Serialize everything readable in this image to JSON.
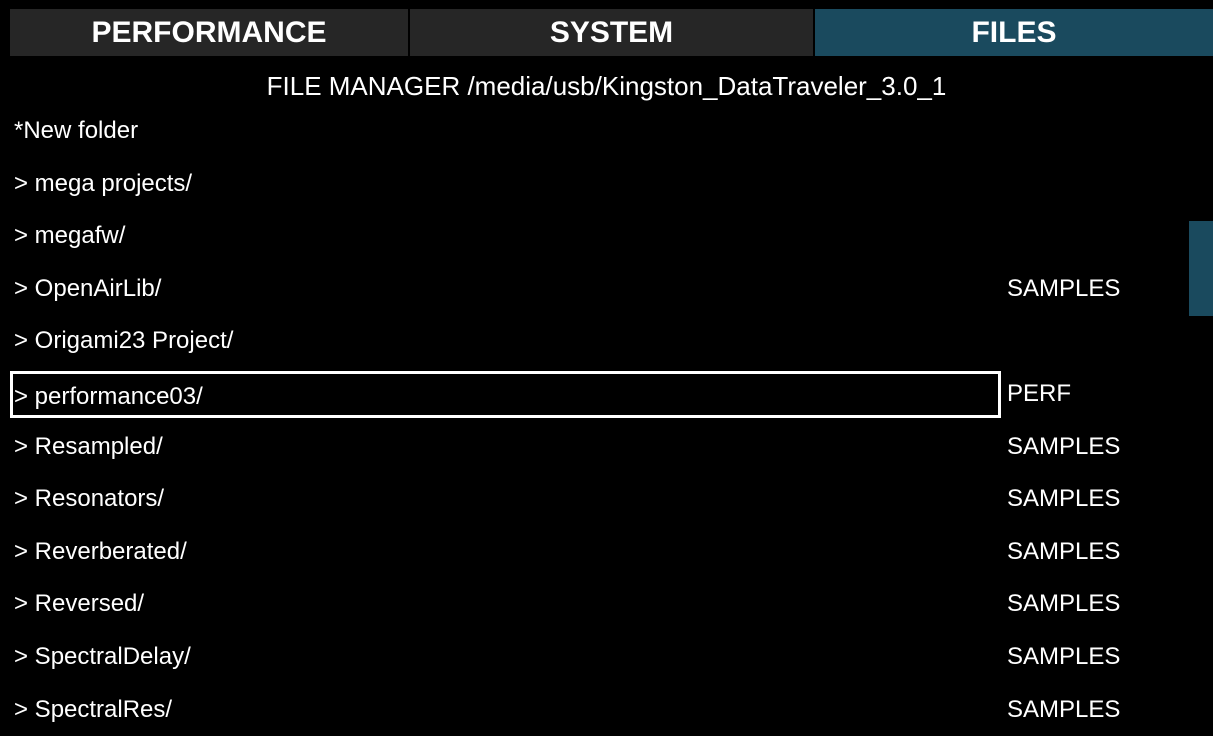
{
  "tabs": [
    {
      "label": "PERFORMANCE",
      "active": false
    },
    {
      "label": "SYSTEM",
      "active": false
    },
    {
      "label": "FILES",
      "active": true
    }
  ],
  "header": {
    "title": "FILE MANAGER /media/usb/Kingston_DataTraveler_3.0_1"
  },
  "files": [
    {
      "name": "*New folder",
      "tag": ""
    },
    {
      "name": "> mega projects/",
      "tag": ""
    },
    {
      "name": "> megafw/",
      "tag": ""
    },
    {
      "name": "> OpenAirLib/",
      "tag": "SAMPLES"
    },
    {
      "name": "> Origami23 Project/",
      "tag": ""
    },
    {
      "name": "> performance03/",
      "tag": "PERF"
    },
    {
      "name": "> Resampled/",
      "tag": "SAMPLES"
    },
    {
      "name": "> Resonators/",
      "tag": "SAMPLES"
    },
    {
      "name": "> Reverberated/",
      "tag": "SAMPLES"
    },
    {
      "name": "> Reversed/",
      "tag": "SAMPLES"
    },
    {
      "name": "> SpectralDelay/",
      "tag": "SAMPLES"
    },
    {
      "name": "> SpectralRes/",
      "tag": "SAMPLES"
    }
  ],
  "selected_index": 5,
  "colors": {
    "background": "#000000",
    "tab_inactive": "#262626",
    "tab_active": "#1a4a5e",
    "scrollbar": "#1a4a5e",
    "text": "#ffffff"
  }
}
